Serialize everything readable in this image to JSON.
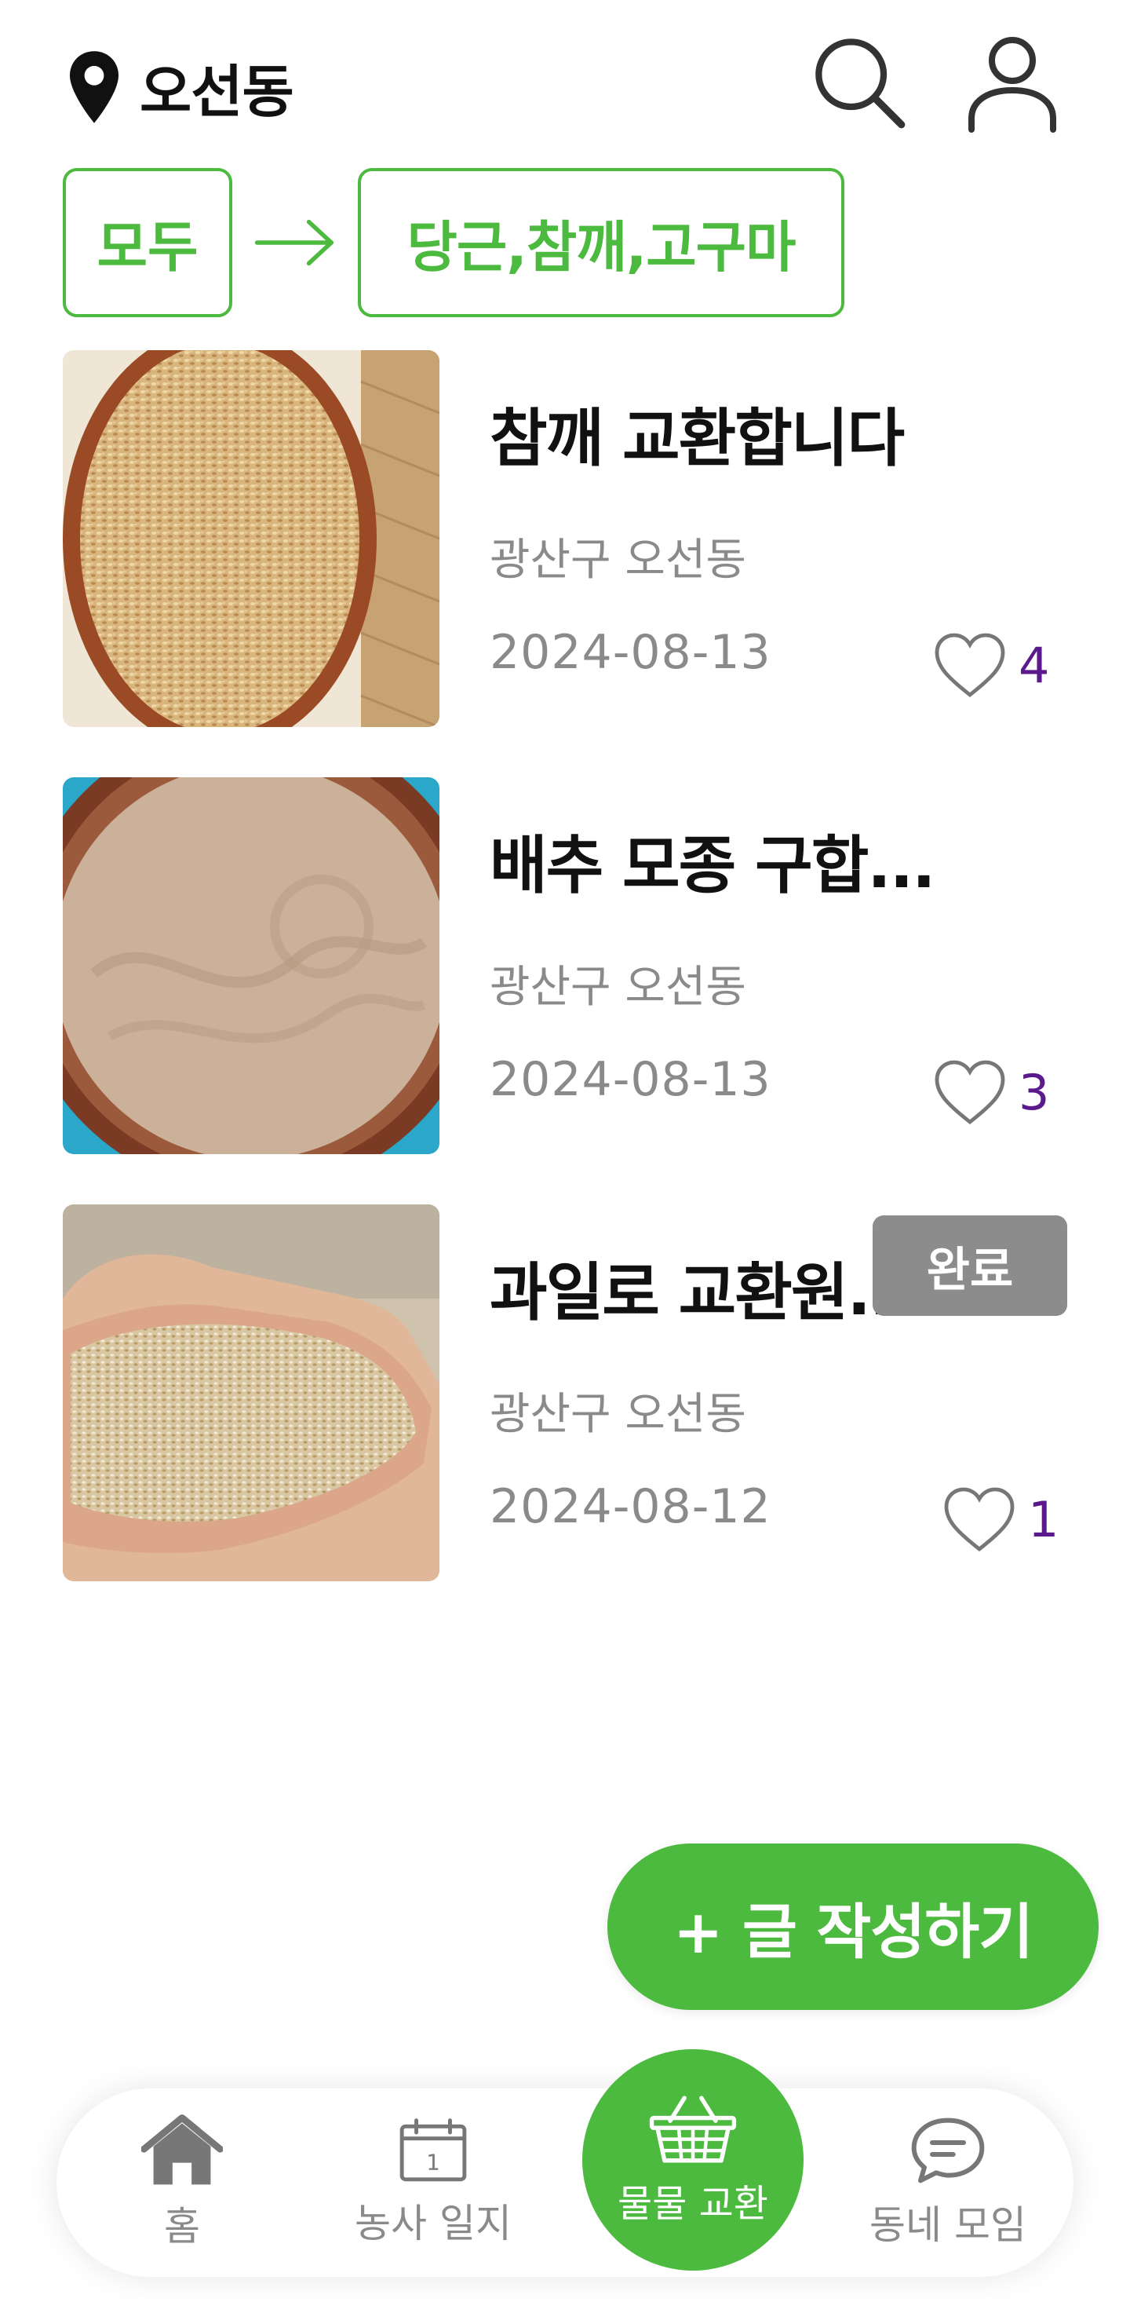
{
  "header": {
    "location": "오선동",
    "icons": [
      "location-pin-icon",
      "search-icon",
      "profile-icon"
    ]
  },
  "filters": {
    "all_label": "모두",
    "selected_label": "당근,참깨,고구마",
    "accent_color": "#4cba3f"
  },
  "posts": [
    {
      "title": "참깨 교환합니다",
      "address": "광산구 오선동",
      "date": "2024-08-13",
      "likes": "4",
      "completed": false
    },
    {
      "title": "배추 모종 구합...",
      "address": "광산구 오선동",
      "date": "2024-08-13",
      "likes": "3",
      "completed": false
    },
    {
      "title": "과일로 교환원...",
      "address": "광산구 오선동",
      "date": "2024-08-12",
      "likes": "1",
      "completed": true,
      "badge": "완료"
    }
  ],
  "fab": {
    "label": "+ 글 작성하기"
  },
  "nav": {
    "items": [
      {
        "label": "홈",
        "icon": "home-icon"
      },
      {
        "label": "농사 일지",
        "icon": "calendar-icon"
      },
      {
        "label": "물물 교환",
        "icon": "basket-icon",
        "active": true
      },
      {
        "label": "동네 모임",
        "icon": "chat-icon"
      }
    ],
    "calendar_day": "1"
  },
  "colors": {
    "accent": "#4cba3f",
    "like_count": "#5a1a8e",
    "badge": "#8c8c8c",
    "muted_text": "#8a8a8a"
  }
}
